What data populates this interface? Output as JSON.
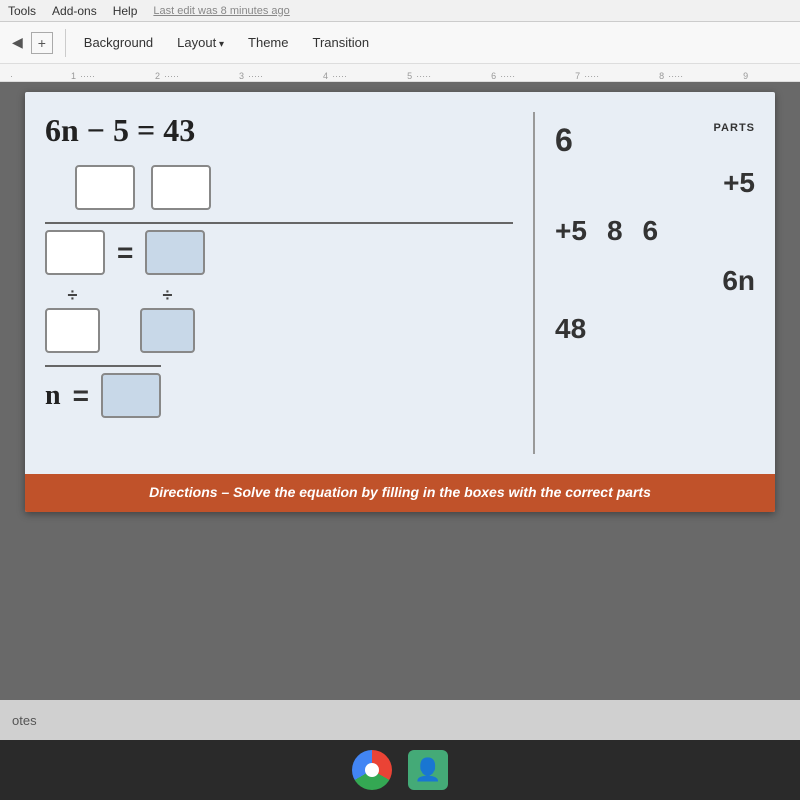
{
  "menubar": {
    "items": [
      "Tools",
      "Add-ons",
      "Help"
    ],
    "last_edit": "Last edit was 8 minutes ago"
  },
  "toolbar": {
    "background_label": "Background",
    "layout_label": "Layout",
    "theme_label": "Theme",
    "transition_label": "Transition"
  },
  "slide": {
    "equation_title": "6n − 5 = 43",
    "instruction": "Directions – Solve the equation by filling in the boxes with the correct parts",
    "parts_label": "PARTS",
    "parts_values": {
      "val1": "6",
      "val2": "+5",
      "val3_a": "+5",
      "val3_b": "8",
      "val3_c": "6",
      "val4": "6n",
      "val5_a": "48"
    },
    "n_label": "n",
    "equals": "="
  },
  "notes": {
    "label": "otes"
  },
  "taskbar": {
    "chrome_label": "Chrome",
    "user_label": "User"
  }
}
